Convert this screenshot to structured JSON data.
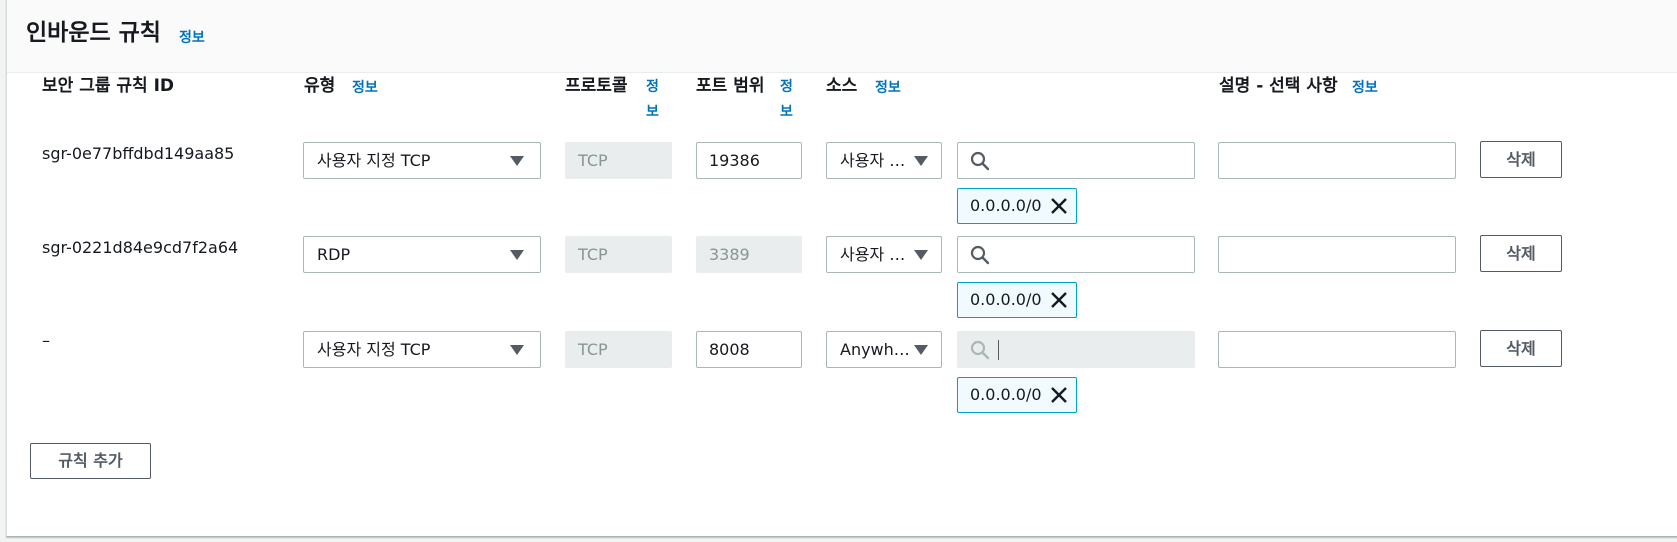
{
  "header": {
    "title": "인바운드 규칙",
    "info": "정보"
  },
  "columns": {
    "rule_id": "보안 그룹 규칙 ID",
    "type": "유형",
    "type_info": "정보",
    "protocol": "프로토콜",
    "protocol_info": "정보",
    "port_range": "포트 범위",
    "port_info": "정보",
    "source": "소스",
    "source_info": "정보",
    "description": "설명 - 선택 사항",
    "description_info": "정보"
  },
  "rules": [
    {
      "id": "sgr-0e77bffdbd149aa85",
      "type": "사용자 지정 TCP",
      "protocol": "TCP",
      "port": "19386",
      "port_disabled": false,
      "source": "사용자 …",
      "cidr_search": "",
      "cidr_search_disabled": false,
      "token": "0.0.0.0/0",
      "description": "",
      "delete": "삭제"
    },
    {
      "id": "sgr-0221d84e9cd7f2a64",
      "type": "RDP",
      "protocol": "TCP",
      "port": "3389",
      "port_disabled": true,
      "source": "사용자 …",
      "cidr_search": "",
      "cidr_search_disabled": false,
      "token": "0.0.0.0/0",
      "description": "",
      "delete": "삭제"
    },
    {
      "id": "–",
      "type": "사용자 지정 TCP",
      "protocol": "TCP",
      "port": "8008",
      "port_disabled": false,
      "source": "Anywh…",
      "cidr_search": "",
      "cidr_search_disabled": true,
      "token": "0.0.0.0/0",
      "description": "",
      "delete": "삭제"
    }
  ],
  "add_rule": "규칙 추가",
  "colors": {
    "link": "#0073bb",
    "token_border": "#00a1c9",
    "token_bg": "#f1faff",
    "disabled_bg": "#eaeded"
  },
  "icons": {
    "search": "search-icon",
    "remove": "close-icon",
    "dropdown": "caret-down-icon"
  }
}
